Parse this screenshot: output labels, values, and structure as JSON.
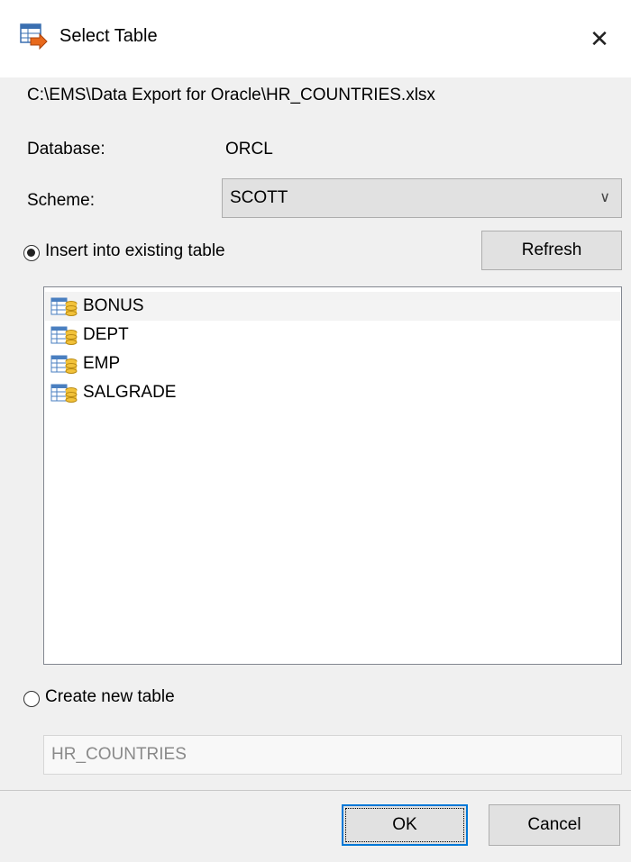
{
  "window": {
    "title": "Select Table",
    "close_glyph": "✕"
  },
  "file_path": "C:\\EMS\\Data Export for Oracle\\HR_COUNTRIES.xlsx",
  "database": {
    "label": "Database:",
    "value": "ORCL"
  },
  "scheme": {
    "label": "Scheme:",
    "value": "SCOTT",
    "chevron": "∨"
  },
  "insert_option": {
    "label": "Insert into existing table",
    "checked": true
  },
  "refresh_label": "Refresh",
  "tables": [
    {
      "name": "BONUS",
      "selected": true
    },
    {
      "name": "DEPT",
      "selected": false
    },
    {
      "name": "EMP",
      "selected": false
    },
    {
      "name": "SALGRADE",
      "selected": false
    }
  ],
  "create_option": {
    "label": "Create new table",
    "checked": false
  },
  "new_table_name": {
    "value": "HR_COUNTRIES"
  },
  "buttons": {
    "ok": "OK",
    "cancel": "Cancel"
  },
  "icons": {
    "title": "table-import-icon",
    "table": "table-icon",
    "close": "close-icon"
  }
}
